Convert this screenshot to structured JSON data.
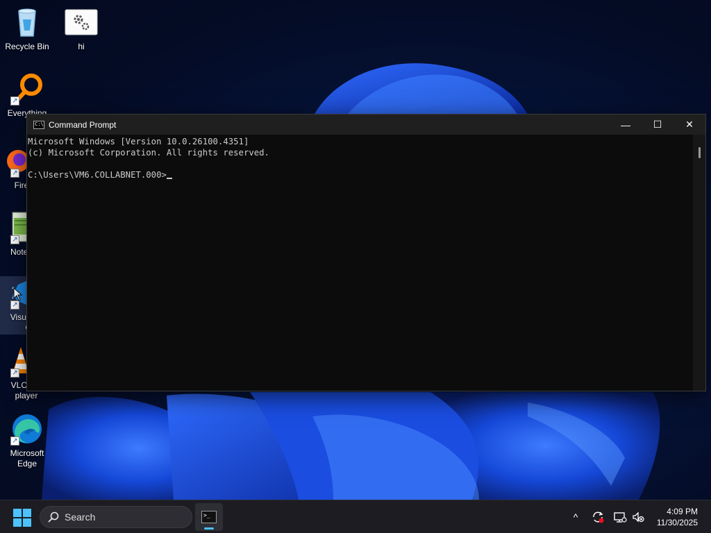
{
  "desktop": {
    "icons": [
      {
        "label": "Recycle Bin"
      },
      {
        "label": "hi"
      },
      {
        "label": "Everything"
      },
      {
        "label": "Fire"
      },
      {
        "label": "Notep"
      },
      {
        "label_line1": "Visual",
        "label_line2": "Co"
      },
      {
        "label_line1": "VLC r",
        "label_line2": "player"
      },
      {
        "label_line1": "Microsoft",
        "label_line2": "Edge"
      }
    ]
  },
  "window": {
    "title": "Command Prompt",
    "icon_text": "C:\\",
    "controls": {
      "minimize": "—",
      "maximize": "☐",
      "close": "✕"
    },
    "console": {
      "line1": "Microsoft Windows [Version 10.0.26100.4351]",
      "line2": "(c) Microsoft Corporation. All rights reserved.",
      "line3": "",
      "prompt": "C:\\Users\\VM6.COLLABNET.000>"
    }
  },
  "taskbar": {
    "search_label": "Search",
    "app_icon_text": ">_",
    "tray": {
      "chevron": "^"
    },
    "time": "4:09 PM",
    "date": "11/30/2025"
  },
  "colors": {
    "console_bg": "#0c0c0c",
    "titlebar_bg": "#1f1f1f",
    "accent": "#4cc2ff",
    "taskbar_bg": "#1c1c22"
  }
}
